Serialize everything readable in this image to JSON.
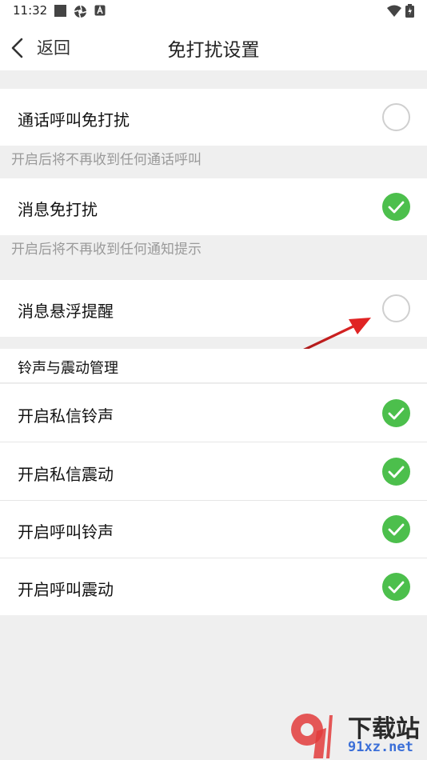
{
  "status_bar": {
    "time": "11:32",
    "left_icons": [
      "square-icon",
      "pinwheel-icon",
      "a-badge-icon"
    ],
    "right_icons": [
      "wifi-icon",
      "battery-icon"
    ]
  },
  "app_bar": {
    "back_label": "返回",
    "title": "免打扰设置"
  },
  "settings": [
    {
      "label": "通话呼叫免打扰",
      "enabled": false,
      "note": "开启后将不再收到任何通话呼叫"
    },
    {
      "label": "消息免打扰",
      "enabled": true,
      "note": "开启后将不再收到任何通知提示"
    },
    {
      "label": "消息悬浮提醒",
      "enabled": false
    }
  ],
  "ringtone_section": {
    "title": "铃声与震动管理",
    "items": [
      {
        "label": "开启私信铃声",
        "enabled": true
      },
      {
        "label": "开启私信震动",
        "enabled": true
      },
      {
        "label": "开启呼叫铃声",
        "enabled": true
      },
      {
        "label": "开启呼叫震动",
        "enabled": true
      }
    ]
  },
  "colors": {
    "accent_green": "#4cbf4c",
    "toggle_off_border": "#cfcfcf",
    "background": "#efefef",
    "annotation_arrow": "#d42020"
  },
  "watermark": {
    "logo_text": "91",
    "text": "下载站",
    "url": "91xz.net"
  }
}
